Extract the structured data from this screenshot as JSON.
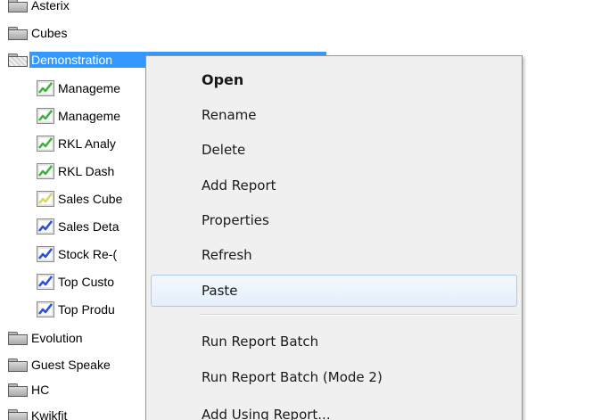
{
  "tree": {
    "folders_top": [
      {
        "label": "Asterix"
      },
      {
        "label": "Cubes"
      }
    ],
    "selected_folder": {
      "label": "Demonstration"
    },
    "reports": [
      {
        "label": "Manageme",
        "icon": "green-chart-icon"
      },
      {
        "label": "Manageme",
        "icon": "green-chart-icon"
      },
      {
        "label": "RKL Analy",
        "icon": "green-chart-icon"
      },
      {
        "label": "RKL Dash",
        "icon": "green-chart-icon"
      },
      {
        "label": "Sales Cube",
        "icon": "yellow-chart-icon"
      },
      {
        "label": "Sales Deta",
        "icon": "blue-chart-icon"
      },
      {
        "label": "Stock Re-(",
        "icon": "blue-chart-icon"
      },
      {
        "label": "Top Custo",
        "icon": "blue-chart-icon"
      },
      {
        "label": "Top Produ",
        "icon": "blue-chart-icon"
      }
    ],
    "folders_bottom": [
      {
        "label": "Evolution"
      },
      {
        "label": "Guest Speake"
      },
      {
        "label": "HC"
      },
      {
        "label": "Kwikfit"
      }
    ],
    "colors": {
      "selection": "#3399ff",
      "green_chart": "#3cb43c",
      "yellow_chart": "#d8d860",
      "blue_chart": "#2a52d8"
    }
  },
  "context_menu": {
    "items": [
      {
        "label": "Open"
      },
      {
        "label": "Rename"
      },
      {
        "label": "Delete"
      },
      {
        "label": "Add Report"
      },
      {
        "label": "Properties"
      },
      {
        "label": "Refresh"
      },
      {
        "label": "Paste"
      },
      {
        "label": "Run Report Batch"
      },
      {
        "label": "Run Report Batch (Mode 2)"
      },
      {
        "label": "Add Using Report..."
      }
    ],
    "hovered_item": "Paste",
    "colors": {
      "background": "#f0f0f0",
      "hover_border": "#a8cbee"
    }
  }
}
